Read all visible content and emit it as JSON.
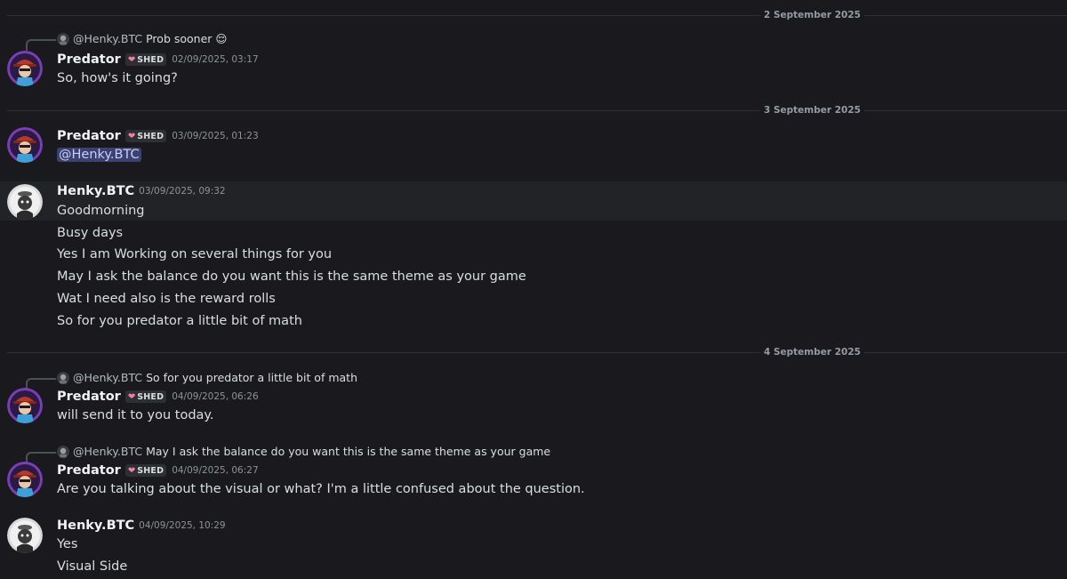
{
  "dates": {
    "d1": "2 September 2025",
    "d2": "3 September 2025",
    "d3": "4 September 2025"
  },
  "tag": {
    "heart": "❤",
    "label": "SHED"
  },
  "m1": {
    "reply_user": "@Henky.BTC",
    "reply_text": "Prob sooner 😌",
    "author": "Predator",
    "time": "02/09/2025, 03:17",
    "lines": [
      "So, how's it going?"
    ]
  },
  "m2": {
    "author": "Predator",
    "time": "03/09/2025, 01:23",
    "mention": "@Henky.BTC"
  },
  "m3": {
    "author": "Henky.BTC",
    "time": "03/09/2025, 09:32",
    "lines": [
      "Goodmorning",
      "Busy days",
      "Yes I am Working on several things for you",
      "May I ask the balance do you want this is the same theme as your game",
      "Wat I need also is the reward rolls",
      "So for you predator a little bit of math"
    ]
  },
  "m4": {
    "reply_user": "@Henky.BTC",
    "reply_text": "So for you predator a little bit of math",
    "author": "Predator",
    "time": "04/09/2025, 06:26",
    "lines": [
      "will send it to you today."
    ]
  },
  "m5": {
    "reply_user": "@Henky.BTC",
    "reply_text": "May I ask the balance do you want this is the same theme as your game",
    "author": "Predator",
    "time": "04/09/2025, 06:27",
    "lines": [
      "Are you talking about the visual or what? I'm a little confused about the question."
    ]
  },
  "m6": {
    "author": "Henky.BTC",
    "time": "04/09/2025, 10:29",
    "lines": [
      "Yes",
      "Visual Side"
    ]
  }
}
